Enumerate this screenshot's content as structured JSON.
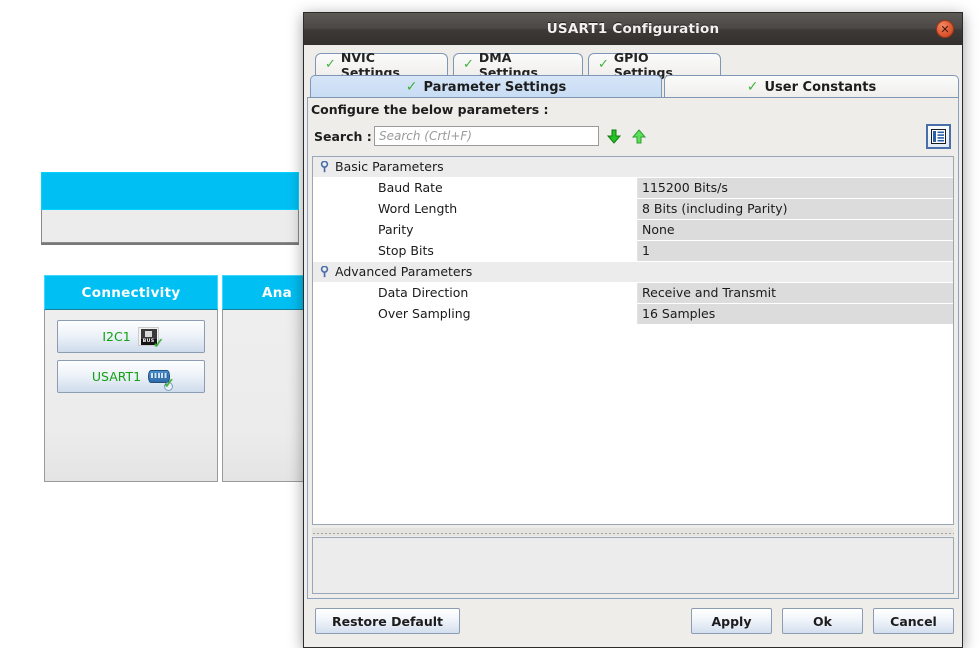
{
  "background": {
    "top_bar": {
      "label": ""
    },
    "panels": [
      {
        "name": "connectivity",
        "title": "Connectivity",
        "items": [
          {
            "label": "I2C1",
            "icon": "i2c-bus-icon",
            "status": "configured-check"
          },
          {
            "label": "USART1",
            "icon": "usart-connector-icon",
            "status": "configured-check"
          }
        ]
      },
      {
        "name": "analog",
        "title": "Ana",
        "items": []
      }
    ]
  },
  "dialog": {
    "title": "USART1 Configuration",
    "close_label": "✕",
    "tabs_top": [
      {
        "label": "NVIC Settings",
        "icon": "green-check-icon",
        "selected": false
      },
      {
        "label": "DMA Settings",
        "icon": "green-check-icon",
        "selected": false
      },
      {
        "label": "GPIO Settings",
        "icon": "green-check-icon",
        "selected": false
      }
    ],
    "tabs_bottom": [
      {
        "label": "Parameter Settings",
        "icon": "green-check-icon",
        "selected": true
      },
      {
        "label": "User Constants",
        "icon": "green-check-icon",
        "selected": false
      }
    ],
    "configure_label": "Configure the below parameters :",
    "search": {
      "label": "Search :",
      "value": "",
      "placeholder": "Search (Crtl+F)",
      "next_icon": "arrow-down-icon",
      "prev_icon": "arrow-up-icon",
      "view_toggle_icon": "table-view-icon"
    },
    "parameters": [
      {
        "type": "group",
        "label": "Basic Parameters"
      },
      {
        "type": "row",
        "name": "Baud Rate",
        "value": "115200 Bits/s"
      },
      {
        "type": "row",
        "name": "Word Length",
        "value": "8 Bits (including Parity)"
      },
      {
        "type": "row",
        "name": "Parity",
        "value": "None"
      },
      {
        "type": "row",
        "name": "Stop Bits",
        "value": "1"
      },
      {
        "type": "group",
        "label": "Advanced Parameters"
      },
      {
        "type": "row",
        "name": "Data Direction",
        "value": "Receive and Transmit"
      },
      {
        "type": "row",
        "name": "Over Sampling",
        "value": "16 Samples"
      }
    ],
    "description": {
      "text": ""
    },
    "buttons": {
      "restore": "Restore Default",
      "apply": "Apply",
      "ok": "Ok",
      "cancel": "Cancel"
    }
  },
  "colors": {
    "accent_cyan": "#00bff3",
    "tab_selected": "#c7dcf4",
    "check_green": "#3fb239",
    "periph_label_green": "#12a012",
    "titlebar": "#45423f",
    "close_red": "#e2613a",
    "value_cell": "#dcdcdc"
  }
}
